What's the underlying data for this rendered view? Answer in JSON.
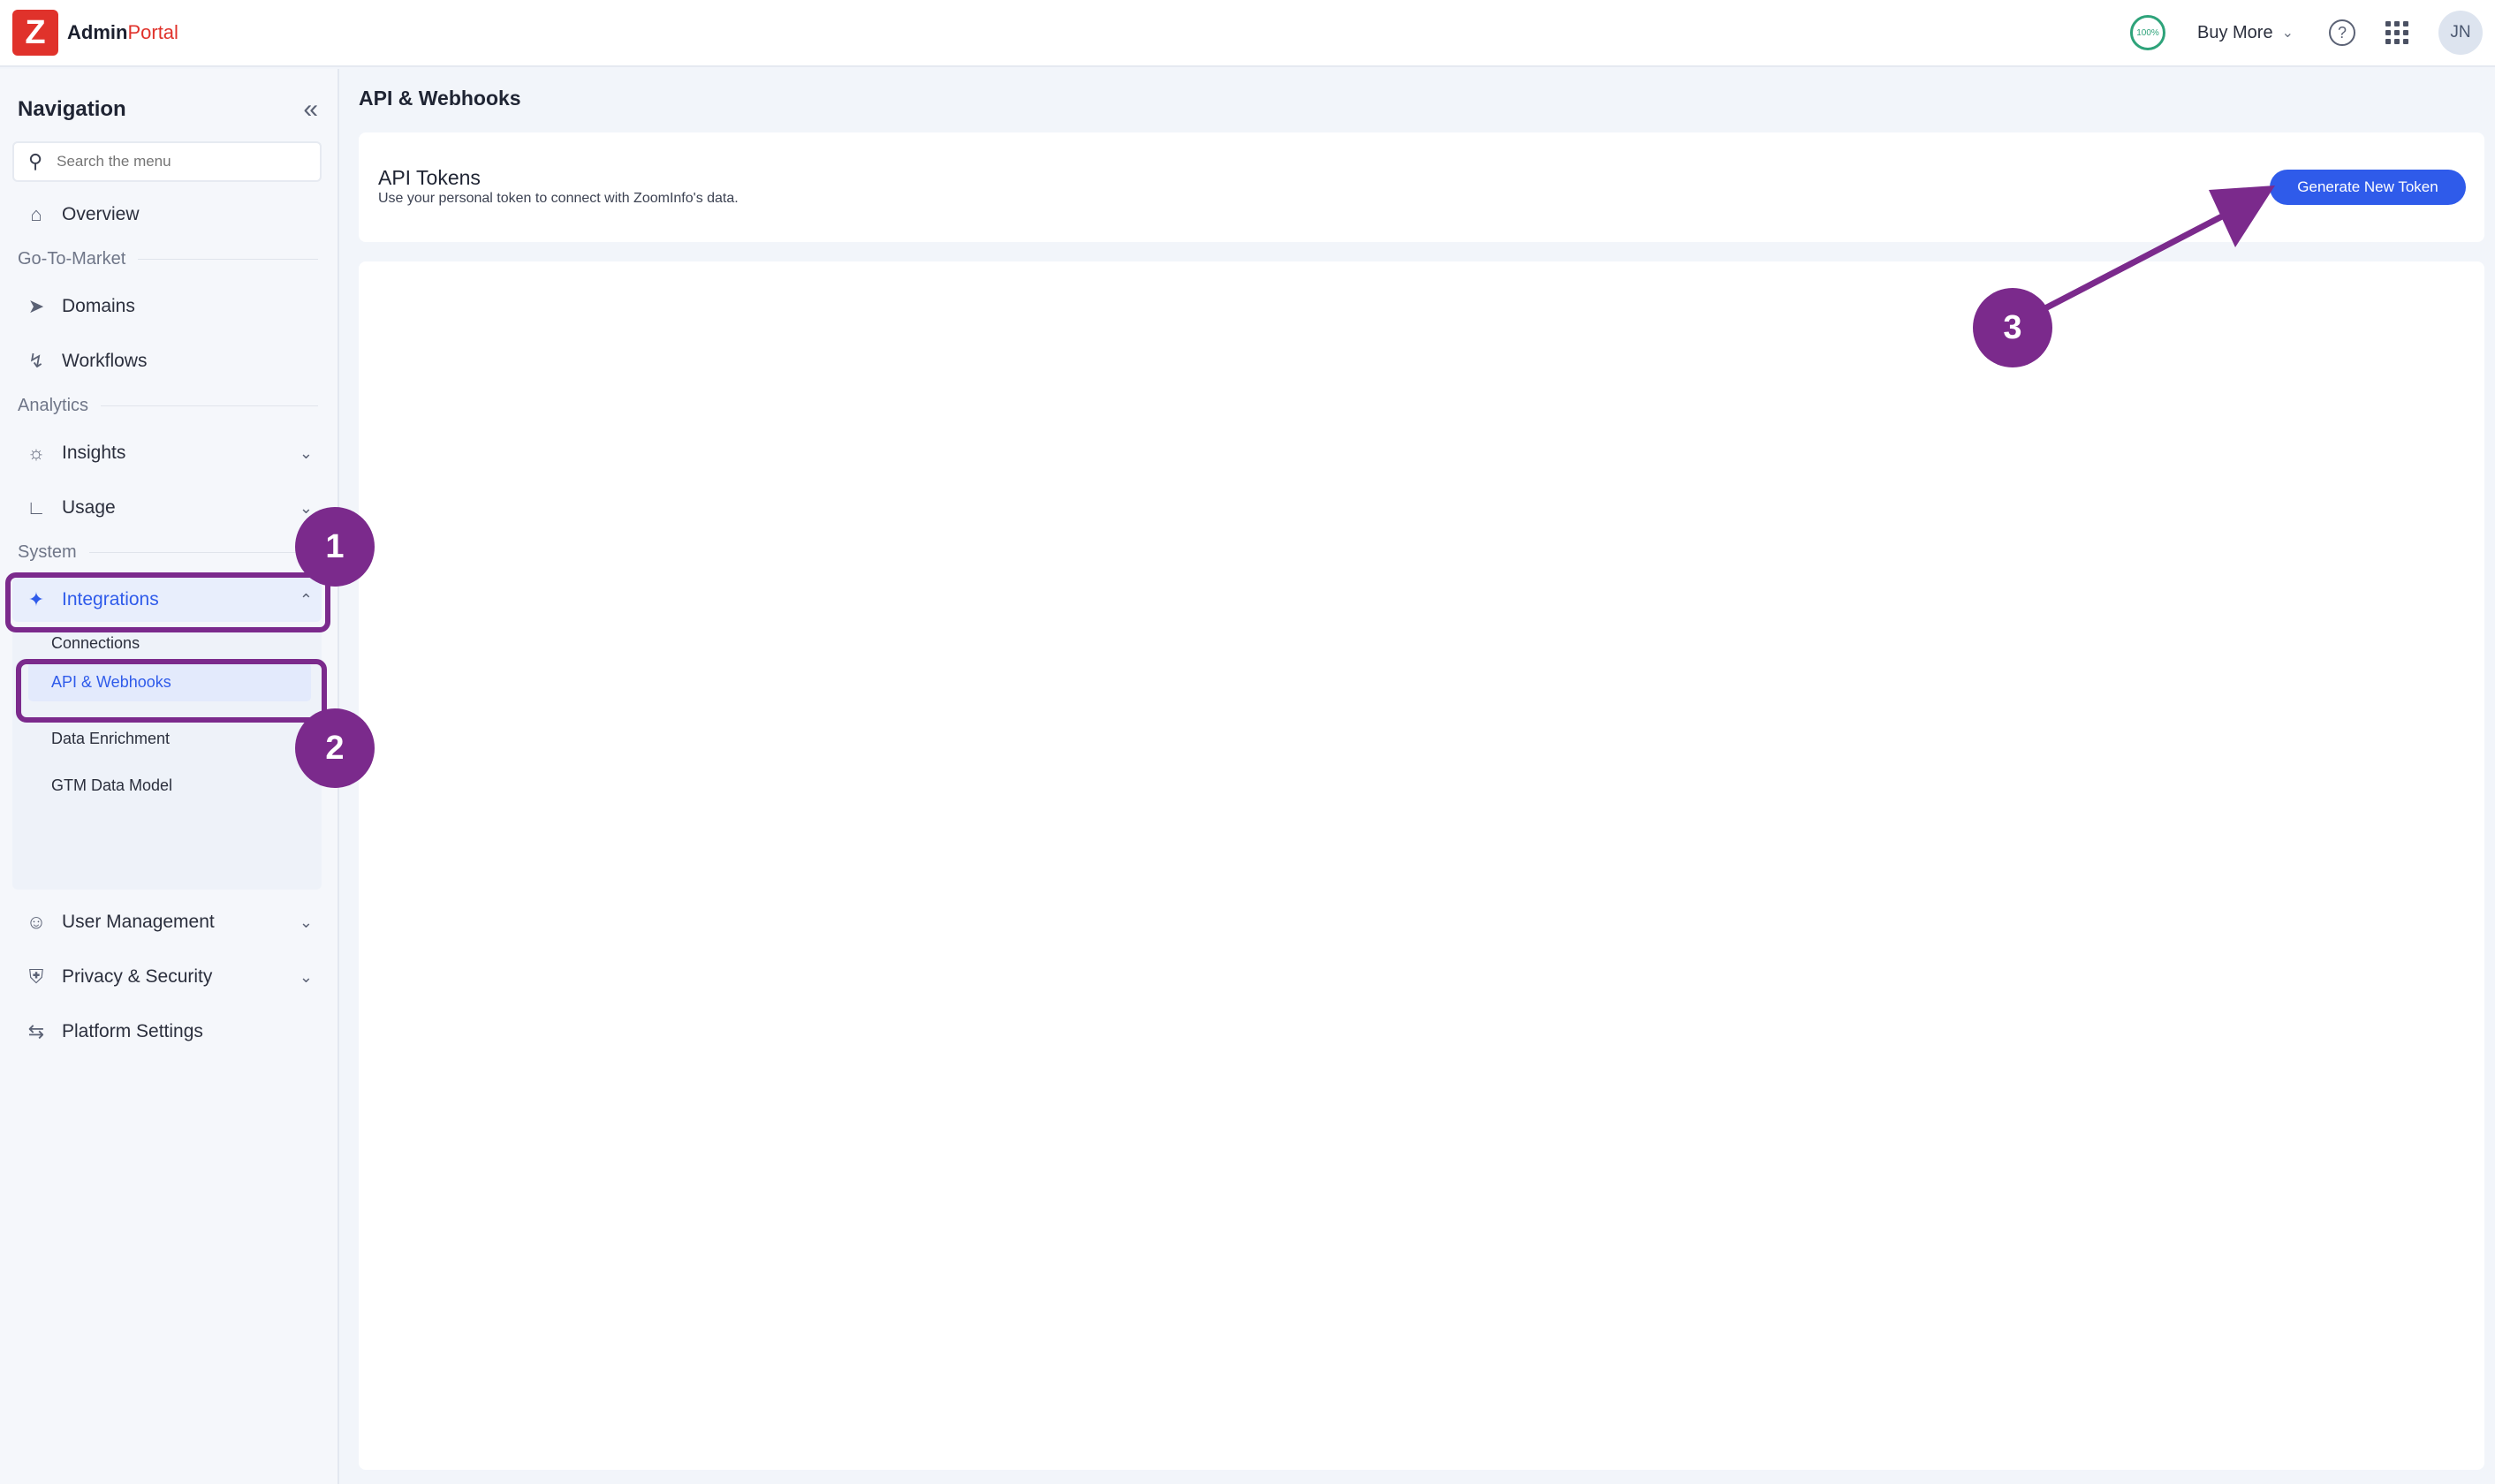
{
  "app": {
    "logo_letter": "Z",
    "name_primary": "Admin",
    "name_accent": "Portal"
  },
  "header": {
    "usage_percent": "100%",
    "buy_more_label": "Buy More",
    "help_glyph": "?",
    "avatar_initials": "JN"
  },
  "sidebar": {
    "title": "Navigation",
    "search_placeholder": "Search the menu",
    "overview": "Overview",
    "section_gtm": "Go-To-Market",
    "domains": "Domains",
    "workflows": "Workflows",
    "section_analytics": "Analytics",
    "insights": "Insights",
    "usage": "Usage",
    "section_system": "System",
    "integrations": "Integrations",
    "integrations_sub": [
      "Connections",
      "API & Webhooks",
      "Data Enrichment",
      "GTM Data Model"
    ],
    "user_management": "User Management",
    "privacy_security": "Privacy & Security",
    "platform_settings": "Platform Settings"
  },
  "main": {
    "page_title": "API & Webhooks",
    "card_title": "API Tokens",
    "card_description": "Use your personal token to connect with ZoomInfo's data.",
    "generate_button": "Generate New Token"
  },
  "annotations": [
    "1",
    "2",
    "3"
  ],
  "colors": {
    "brand_red": "#e0322b",
    "accent_blue": "#2f5bea",
    "annotation_purple": "#7b2a8c"
  }
}
